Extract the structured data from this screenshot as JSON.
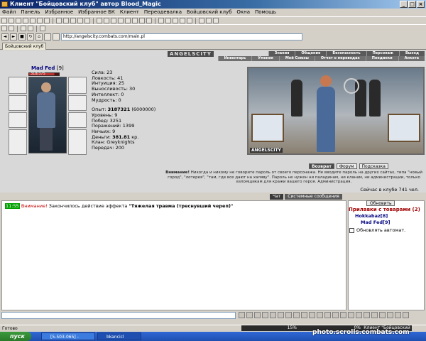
{
  "window": {
    "title": "Клиент \"Бойцовский клуб\" автор Blood_Magic",
    "buttons": [
      "_",
      "□",
      "×"
    ]
  },
  "menu": [
    "Файл",
    "Панель",
    "Избранное",
    "Избранное БК",
    "Клиент",
    "Переодевалка",
    "Бойцовский клуб",
    "Окна",
    "Помощь"
  ],
  "address": {
    "url": "http://angelscity.combats.com/main.pl"
  },
  "tabs": [
    {
      "label": "Бойцовский клуб"
    }
  ],
  "game_nav": {
    "logo": "ANGELSCITY",
    "row1": [
      "Знания",
      "Общение",
      "Безопасность",
      "Персонаж",
      "Выход"
    ],
    "row2": [
      "Инвентарь",
      "Умения",
      "Мой Союзы",
      "Отчет о переводах",
      "Поединки",
      "Анкета"
    ]
  },
  "character": {
    "name": "Mad Fed",
    "level": "[9]",
    "hp_label": "318/375",
    "hp_fraction": 0.85,
    "stats": [
      {
        "label": "Сила:",
        "value": "23"
      },
      {
        "label": "Ловкость:",
        "value": "41"
      },
      {
        "label": "Интуиция:",
        "value": "25"
      },
      {
        "label": "Выносливость:",
        "value": "30"
      },
      {
        "label": "Интеллект:",
        "value": "0"
      },
      {
        "label": "Мудрость:",
        "value": "0"
      }
    ],
    "info": [
      {
        "label": "Опыт:",
        "value": "3187321",
        "extra": "(6000000)"
      },
      {
        "label": "Уровень:",
        "value": "9"
      },
      {
        "label": "Побед:",
        "value": "3251"
      },
      {
        "label": "Поражений:",
        "value": "1399"
      },
      {
        "label": "Ничьих:",
        "value": "9"
      },
      {
        "label": "Деньги:",
        "value": "381.81",
        "extra": "кр."
      },
      {
        "label": "Клан:",
        "value": "Greyknights"
      },
      {
        "label": "Передач:",
        "value": "200"
      }
    ]
  },
  "scene": {
    "logo": "ANGELSCITY"
  },
  "action_buttons": [
    "Возврат",
    "Форум",
    "Подсказка"
  ],
  "warning": {
    "bold": "Внимание!",
    "text": "Никогда и никому не говорите пароль от своего персонажа. Не вводите пароль на других сайтах, типа \"новый город\", \"лотерея\", \"там, где все дают на халяву\". Пароль не нужен ни паладинам, ни кланам, ни администрации, только взломщикам для кражи вашего героя.",
    "admin": "Администрация."
  },
  "online": "Сейчас в клубе 741 чел.",
  "chat_tabs": [
    "Чат",
    "Системные сообщения"
  ],
  "chat": {
    "time": "11:55",
    "warn": "Внимание!",
    "text": "Закончилось действие эффекта",
    "effect": "\"Тяжелая травма (треснувший череп)\""
  },
  "side": {
    "refresh": "Обновить",
    "title": "Прилавки с товарами (2)",
    "users": [
      "Hokkabaz[8]",
      "Mad Fed[9]"
    ],
    "auto": "Обновлять автомат."
  },
  "status": {
    "text": "Готово",
    "p1": "15%",
    "p2": "0%",
    "p3": "Клиент \"Бойцовский Клуб\""
  },
  "taskbar": {
    "start": "пуск",
    "tasks": [
      "[5-503-065] - Окн...",
      "bkancicl"
    ],
    "watermark": "photo.scrolls.combats.com"
  }
}
